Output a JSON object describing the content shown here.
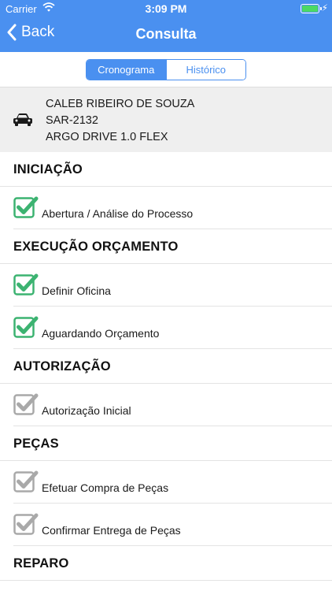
{
  "status": {
    "carrier": "Carrier",
    "time": "3:09 PM",
    "battery_color": "#4cd964"
  },
  "nav": {
    "back_label": "Back",
    "title": "Consulta"
  },
  "tabs": [
    {
      "label": "Cronograma",
      "active": true
    },
    {
      "label": "Histórico",
      "active": false
    }
  ],
  "vehicle": {
    "icon": "car-icon",
    "owner": "CALEB RIBEIRO DE SOUZA",
    "plate": "SAR-2132",
    "model": "ARGO DRIVE 1.0 FLEX"
  },
  "colors": {
    "accent": "#4a90f0",
    "done_check": "#3cb371",
    "pending_check": "#a9a9a9"
  },
  "sections": [
    {
      "title": "INICIAÇÃO",
      "items": [
        {
          "label": "Abertura / Análise do Processo",
          "done": true
        }
      ]
    },
    {
      "title": "EXECUÇÃO ORÇAMENTO",
      "items": [
        {
          "label": "Definir Oficina",
          "done": true
        },
        {
          "label": "Aguardando Orçamento",
          "done": true
        }
      ]
    },
    {
      "title": "AUTORIZAÇÃO",
      "items": [
        {
          "label": "Autorização Inicial",
          "done": false
        }
      ]
    },
    {
      "title": "PEÇAS",
      "items": [
        {
          "label": "Efetuar Compra de Peças",
          "done": false
        },
        {
          "label": "Confirmar Entrega de Peças",
          "done": false
        }
      ]
    },
    {
      "title": "REPARO",
      "items": []
    }
  ]
}
